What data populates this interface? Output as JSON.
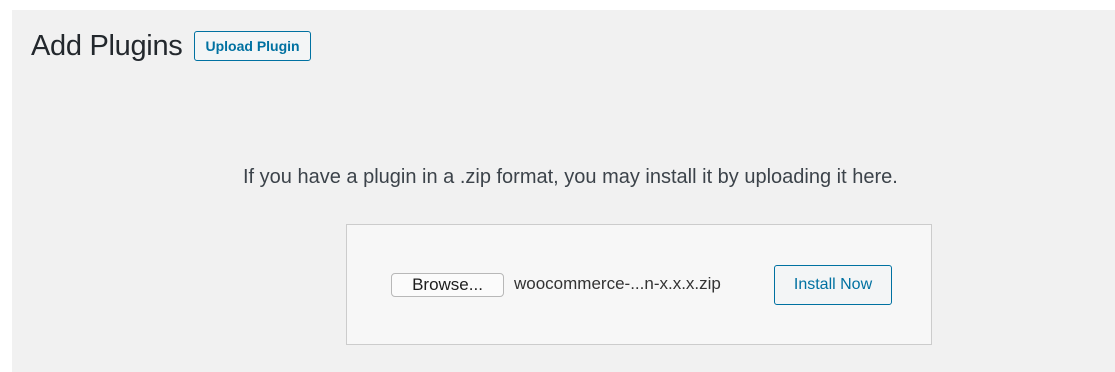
{
  "header": {
    "title": "Add Plugins",
    "upload_button_label": "Upload Plugin"
  },
  "upload": {
    "help_text": "If you have a plugin in a .zip format, you may install it by uploading it here.",
    "browse_label": "Browse...",
    "file_name": "woocommerce-...n-x.x.x.zip",
    "install_label": "Install Now"
  },
  "colors": {
    "admin_background": "#f1f1f1",
    "accent": "#0071a1",
    "text": "#23282d"
  }
}
